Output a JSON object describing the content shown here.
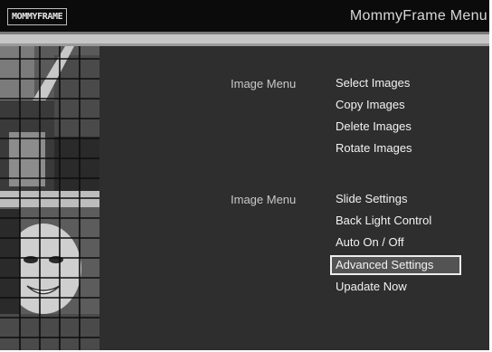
{
  "header": {
    "logo_text": "MOMMYFRAME",
    "title": "MommyFrame Menu"
  },
  "sections": [
    {
      "label": "Image Menu",
      "items": [
        {
          "label": "Select Images",
          "selected": false
        },
        {
          "label": "Copy Images",
          "selected": false
        },
        {
          "label": "Delete Images",
          "selected": false
        },
        {
          "label": "Rotate Images",
          "selected": false
        }
      ]
    },
    {
      "label": "Image Menu",
      "items": [
        {
          "label": "Slide Settings",
          "selected": false
        },
        {
          "label": "Back Light Control",
          "selected": false
        },
        {
          "label": "Auto On / Off",
          "selected": false
        },
        {
          "label": "Advanced Settings",
          "selected": true
        },
        {
          "label": "Upadate Now",
          "selected": false
        }
      ]
    }
  ]
}
